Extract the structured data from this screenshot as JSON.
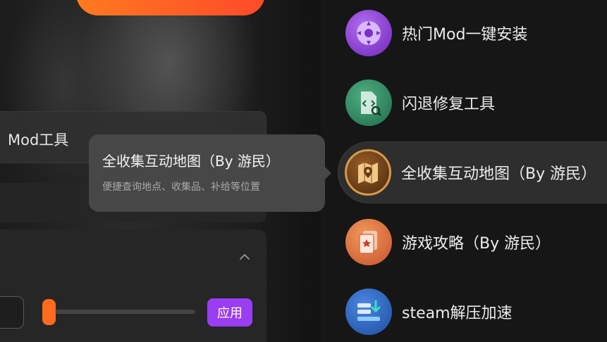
{
  "left_panel": {
    "mod_tool_label": "Mod工具",
    "apply_label": "应用"
  },
  "tooltip": {
    "title": "全收集互动地图（By 游民）",
    "description": "便捷查询地点、收集品、补给等位置"
  },
  "menu": {
    "items": [
      {
        "label": "热门Mod一键安装",
        "icon": "mod-install-icon",
        "color": "#8a3fd0"
      },
      {
        "label": "闪退修复工具",
        "icon": "crash-fix-icon",
        "color": "#2f8a63"
      },
      {
        "label": "全收集互动地图（By 游民）",
        "icon": "map-icon",
        "color": "#b8742e"
      },
      {
        "label": "游戏攻略（By 游民）",
        "icon": "guide-cards-icon",
        "color": "#e26a3b"
      },
      {
        "label": "steam解压加速",
        "icon": "unzip-speed-icon",
        "color": "#2a5fb8"
      }
    ]
  },
  "colors": {
    "accent_orange": "#ff6a1f",
    "accent_purple": "#9b3df2"
  }
}
